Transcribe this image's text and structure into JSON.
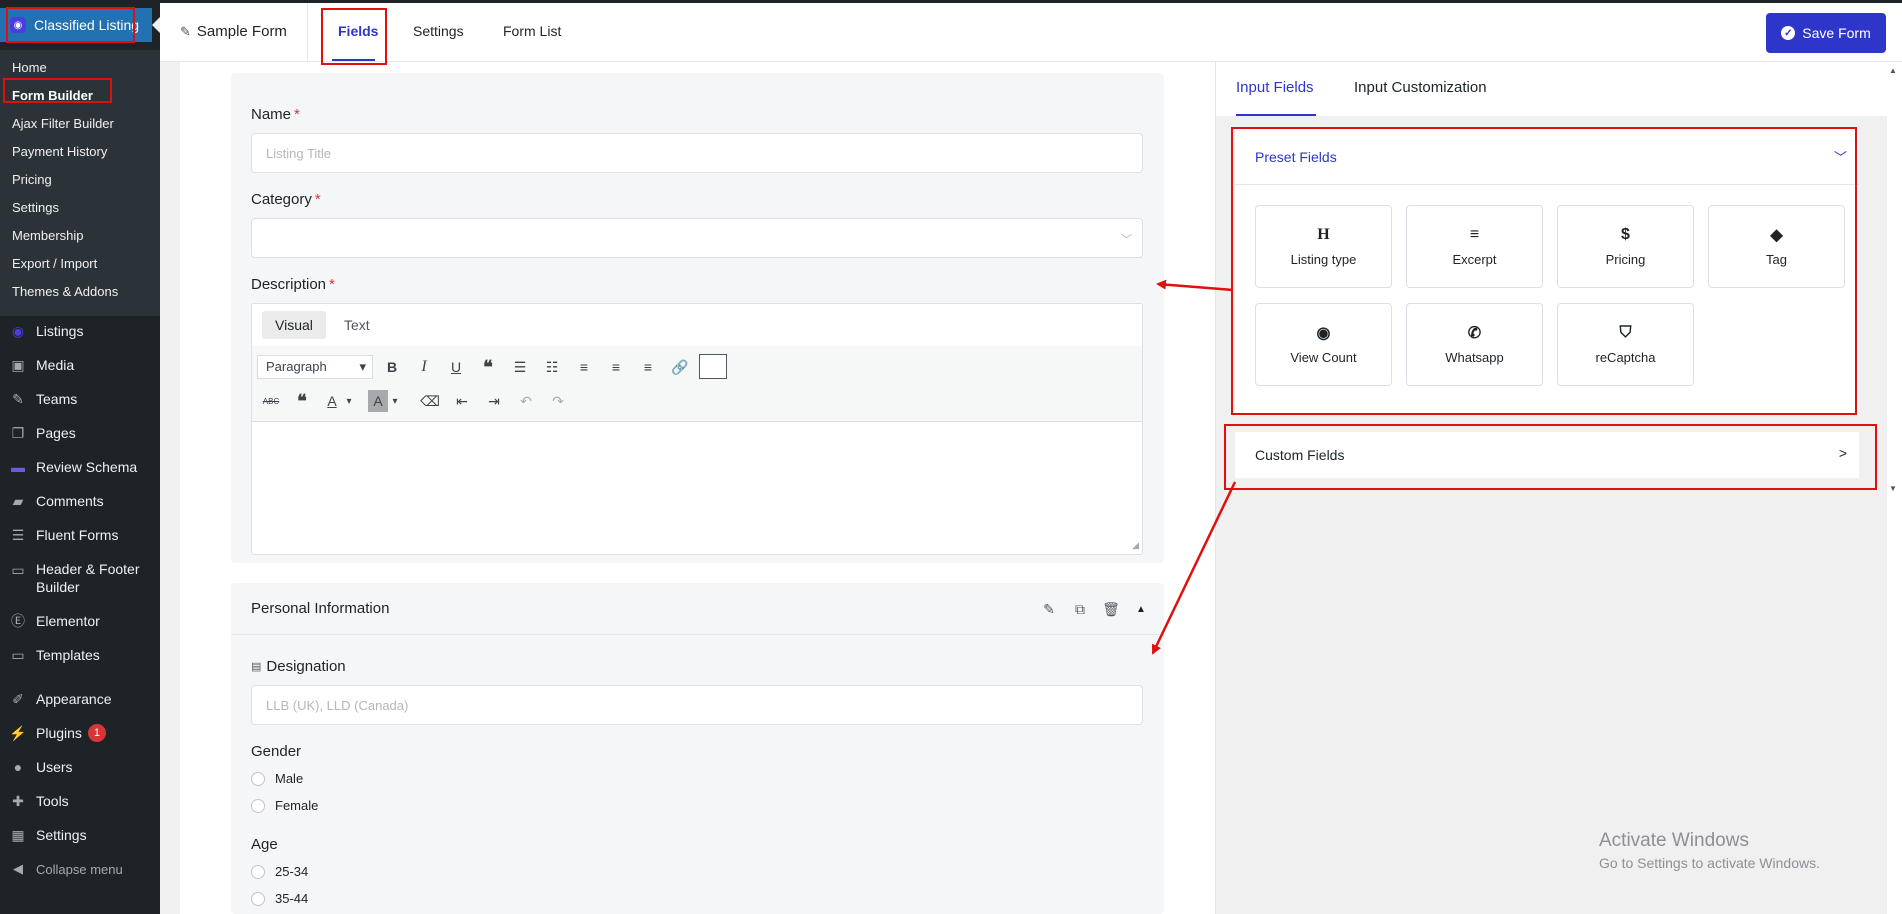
{
  "sidebar": {
    "plugin_title": "Classified Listing",
    "submenu": [
      "Home",
      "Form Builder",
      "Ajax Filter Builder",
      "Payment History",
      "Pricing",
      "Settings",
      "Membership",
      "Export / Import",
      "Themes & Addons"
    ],
    "menu": [
      {
        "label": "Listings",
        "icon": "pin-icon"
      },
      {
        "label": "Media",
        "icon": "media-icon"
      },
      {
        "label": "Teams",
        "icon": "brush-icon"
      },
      {
        "label": "Pages",
        "icon": "pages-icon"
      },
      {
        "label": "Review Schema",
        "icon": "schema-icon"
      },
      {
        "label": "Comments",
        "icon": "comment-icon"
      },
      {
        "label": "Fluent Forms",
        "icon": "forms-icon"
      },
      {
        "label": "Header & Footer Builder",
        "icon": "folder-icon"
      },
      {
        "label": "Elementor",
        "icon": "elementor-icon"
      },
      {
        "label": "Templates",
        "icon": "folder-icon"
      },
      {
        "label": "Appearance",
        "icon": "appearance-icon"
      },
      {
        "label": "Plugins",
        "icon": "plugin-icon",
        "badge": "1"
      },
      {
        "label": "Users",
        "icon": "user-icon"
      },
      {
        "label": "Tools",
        "icon": "wrench-icon"
      },
      {
        "label": "Settings",
        "icon": "settings-icon"
      },
      {
        "label": "Collapse menu",
        "icon": "collapse-icon"
      }
    ]
  },
  "topbar": {
    "form_name": "Sample Form",
    "tabs": [
      "Fields",
      "Settings",
      "Form List"
    ],
    "save_label": "Save Form"
  },
  "form": {
    "name_label": "Name",
    "name_placeholder": "Listing Title",
    "category_label": "Category",
    "description_label": "Description",
    "editor_tabs": [
      "Visual",
      "Text"
    ],
    "paragraph_select": "Paragraph",
    "personal_section_title": "Personal Information",
    "designation_label": "Designation",
    "designation_placeholder": "LLB (UK), LLD (Canada)",
    "gender_label": "Gender",
    "gender_options": [
      "Male",
      "Female"
    ],
    "age_label": "Age",
    "age_options": [
      "25-34",
      "35-44"
    ]
  },
  "right_panel": {
    "tabs": [
      "Input Fields",
      "Input Customization"
    ],
    "preset_title": "Preset Fields",
    "preset_fields": [
      {
        "label": "Listing type",
        "icon": "heading-icon"
      },
      {
        "label": "Excerpt",
        "icon": "align-icon"
      },
      {
        "label": "Pricing",
        "icon": "dollar-icon"
      },
      {
        "label": "Tag",
        "icon": "tag-icon"
      },
      {
        "label": "View Count",
        "icon": "eye-icon"
      },
      {
        "label": "Whatsapp",
        "icon": "whatsapp-icon"
      },
      {
        "label": "reCaptcha",
        "icon": "shield-icon"
      }
    ],
    "custom_title": "Custom Fields"
  },
  "watermark": {
    "line1": "Activate Windows",
    "line2": "Go to Settings to activate Windows."
  },
  "colors": {
    "accent": "#2d36c9",
    "wp_sidebar": "#1d2327",
    "annotation_red": "#e01010",
    "required": "#d63638"
  }
}
